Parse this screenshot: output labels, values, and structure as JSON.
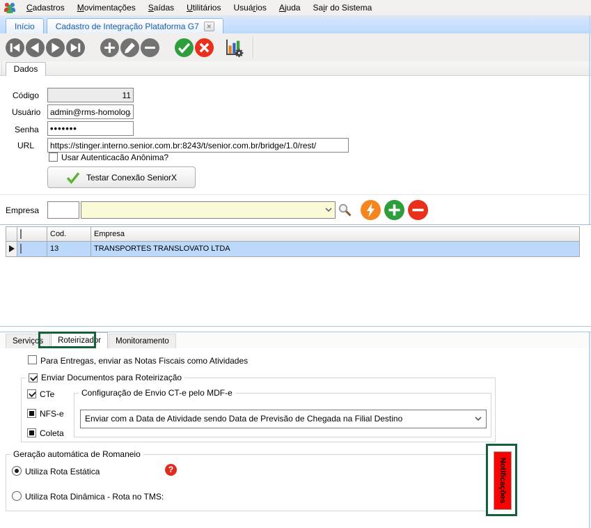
{
  "menubar": {
    "items": [
      {
        "label": "Cadastros",
        "accel": "0"
      },
      {
        "label": "Movimentações",
        "accel": "0"
      },
      {
        "label": "Saídas",
        "accel": "0"
      },
      {
        "label": "Utilitários",
        "accel": "0"
      },
      {
        "label": "Usuários",
        "accel": "4"
      },
      {
        "label": "Ajuda",
        "accel": "0"
      },
      {
        "label": "Sair do Sistema",
        "accel": "2"
      }
    ]
  },
  "tabbar": {
    "home_tab": "Início",
    "active_tab": "Cadastro de Integração Plataforma G7",
    "close_icon": "✕"
  },
  "page": {
    "dados_tab": "Dados"
  },
  "form": {
    "codigo_label": "Código",
    "codigo_value": "11",
    "usuario_label": "Usuário",
    "usuario_value": "admin@rms-homologaca",
    "senha_label": "Senha",
    "senha_value": "•••••••",
    "url_label": "URL",
    "url_value": "https://stinger.interno.senior.com.br:8243/t/senior.com.br/bridge/1.0/rest/",
    "anonymous_checkbox_label": "Usar Autenticacão Anônima?",
    "anonymous_checked": false,
    "test_connection_button": "Testar Conexão SeniorX"
  },
  "empresa": {
    "label": "Empresa",
    "code_value": "",
    "name_value": ""
  },
  "grid": {
    "col_cod": "Cod.",
    "col_empresa": "Empresa",
    "rows": [
      {
        "cod": "13",
        "empresa": "TRANSPORTES TRANSLOVATO LTDA",
        "selected": true,
        "checked": false
      }
    ]
  },
  "bottom_tabs": {
    "servicos": "Serviços",
    "roteirizador": "Roteirizador",
    "monitoramento": "Monitoramento",
    "active": "Roteirizador"
  },
  "roteirizador": {
    "entregas_checkbox_label": "Para Entregas, enviar as Notas Fiscais como Atividades",
    "entregas_checked": false,
    "documentos_group_label": "Enviar Documentos para Roteirização",
    "documentos_checked": true,
    "cte_label": "CTe",
    "cte_state": "checked",
    "nfse_label": "NFS-e",
    "nfse_state": "mixed",
    "coleta_label": "Coleta",
    "coleta_state": "mixed",
    "config_group_label": "Configuração de Envio CT-e pelo MDF-e",
    "config_dropdown_value": "Enviar com a Data de Atividade sendo Data de Previsão de Chegada na Filial Destino",
    "romaneio_group_label": "Geração automática de Romaneio",
    "rota_estatica_label": "Utiliza Rota Estática",
    "rota_estatica_selected": true,
    "rota_dinamica_label": "Utiliza Rota Dinâmica - Rota no TMS:",
    "rota_dinamica_selected": false,
    "help_icon": "?"
  },
  "notifications": {
    "label": "Notificações"
  },
  "colors": {
    "accent_blue": "#1b5aa7",
    "selected_row": "#bcd9fb",
    "combo_yellow": "#fbfad6",
    "confirm_green": "#2f9e3c",
    "cancel_red": "#e8301c",
    "lightning_orange": "#f5861f",
    "annotation_green": "#14603a",
    "notification_red": "#fb0100",
    "help_red": "#e02b20"
  }
}
